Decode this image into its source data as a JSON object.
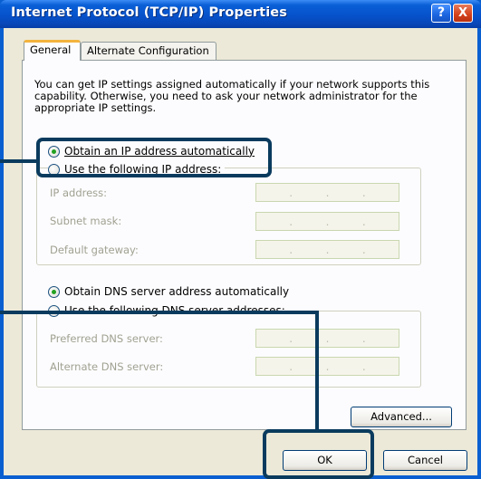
{
  "window": {
    "title": "Internet Protocol (TCP/IP) Properties",
    "help_glyph": "?",
    "close_glyph": "X"
  },
  "tabs": [
    {
      "label": "General"
    },
    {
      "label": "Alternate Configuration"
    }
  ],
  "intro_text": "You can get IP settings assigned automatically if your network supports this capability. Otherwise, you need to ask your network administrator for the appropriate IP settings.",
  "ip_section": {
    "option_auto": "Obtain an IP address automatically",
    "option_manual": "Use the following IP address:",
    "fields": [
      {
        "label": "IP address:"
      },
      {
        "label": "Subnet mask:"
      },
      {
        "label": "Default gateway:"
      }
    ]
  },
  "dns_section": {
    "option_auto": "Obtain DNS server address automatically",
    "option_manual": "Use the following DNS server addresses:",
    "fields": [
      {
        "label": "Preferred DNS server:"
      },
      {
        "label": "Alternate DNS server:"
      }
    ]
  },
  "buttons": {
    "advanced": "Advanced...",
    "ok": "OK",
    "cancel": "Cancel"
  },
  "ip_dot": ".",
  "colors": {
    "title_bar": "#0652cc",
    "dialog_bg": "#ece9d8",
    "callout": "#0a3b5e",
    "radio_selected": "#21a121"
  }
}
